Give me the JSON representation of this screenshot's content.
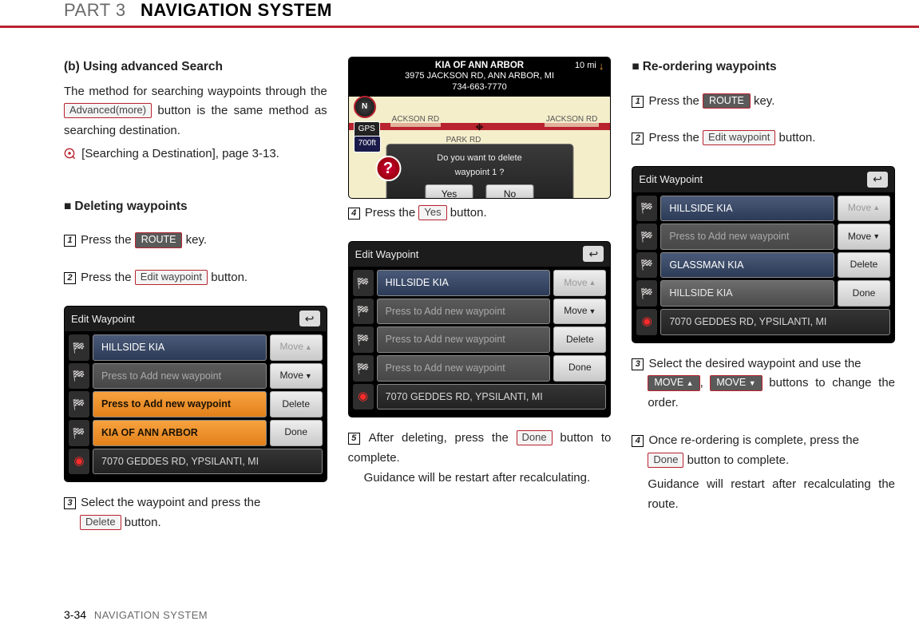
{
  "header": {
    "part": "PART 3",
    "title": "NAVIGATION SYSTEM"
  },
  "footer": {
    "page": "3-34",
    "section": "NAVIGATION SYSTEM"
  },
  "col1": {
    "advSearch": {
      "heading": "(b) Using advanced Search",
      "body1a": "The method for searching waypoints through the ",
      "btn_advanced": "Advanced(more)",
      "body1b": " button is the same method as searching destination.",
      "ref": "[Searching a Destination], page 3-13."
    },
    "deleting": {
      "heading": "Deleting waypoints",
      "step1a": "Press the ",
      "route_key": "ROUTE",
      "step1b": " key.",
      "step2a": "Press the ",
      "edit_waypoint_btn": "Edit waypoint",
      "step2b": " button.",
      "step3a": "Select the waypoint and press the ",
      "delete_btn": "Delete",
      "step3b": " button."
    },
    "ss1": {
      "title": "Edit Waypoint",
      "rows": [
        {
          "label": "HILLSIDE KIA"
        },
        {
          "label": "Press to Add new waypoint"
        },
        {
          "label": "Press to Add new waypoint"
        },
        {
          "label": "KIA OF ANN ARBOR"
        }
      ],
      "final": "7070 GEDDES RD, YPSILANTI, MI",
      "btns": {
        "moveUp": "Move",
        "moveDown": "Move",
        "delete": "Delete",
        "done": "Done"
      }
    }
  },
  "col2": {
    "map": {
      "title1": "KIA OF ANN ARBOR",
      "title2": "3975 JACKSON RD, ANN ARBOR, MI",
      "phone": "734-663-7770",
      "dist": "10 mi",
      "gps": "GPS",
      "scale": "700ft",
      "road_left": "ACKSON RD",
      "road_right": "JACKSON RD",
      "park": "PARK RD",
      "compass": "N",
      "dialog_text1": "Do you want to delete",
      "dialog_text2": "waypoint 1 ?",
      "yes": "Yes",
      "no": "No"
    },
    "step4a": "Press the ",
    "yes_btn": "Yes",
    "step4b": " button.",
    "ss2": {
      "title": "Edit Waypoint",
      "rows": [
        {
          "label": "HILLSIDE KIA"
        },
        {
          "label": "Press to Add new waypoint"
        },
        {
          "label": "Press to Add new waypoint"
        },
        {
          "label": "Press to Add new waypoint"
        }
      ],
      "final": "7070 GEDDES RD, YPSILANTI, MI",
      "btns": {
        "moveUp": "Move",
        "moveDown": "Move",
        "delete": "Delete",
        "done": "Done"
      }
    },
    "step5a": "After deleting, press the ",
    "done_btn": "Done",
    "step5b": " button to complete.",
    "step5c": "Guidance will be  restart after recalculating."
  },
  "col3": {
    "heading": "Re-ordering waypoints",
    "step1a": "Press the ",
    "route_key": "ROUTE",
    "step1b": " key.",
    "step2a": "Press the ",
    "edit_waypoint_btn": "Edit waypoint",
    "step2b": " button.",
    "ss3": {
      "title": "Edit Waypoint",
      "rows": [
        {
          "label": "HILLSIDE KIA"
        },
        {
          "label": "Press to Add new waypoint"
        },
        {
          "label": "GLASSMAN KIA"
        },
        {
          "label": "HILLSIDE KIA"
        }
      ],
      "final": "7070 GEDDES RD, YPSILANTI, MI",
      "btns": {
        "moveUp": "Move",
        "moveDown": "Move",
        "delete": "Delete",
        "done": "Done"
      }
    },
    "step3a": "Select the desired waypoint and use the ",
    "moveUp": "MOVE",
    "moveDown": "MOVE",
    "step3b": " buttons to change the order.",
    "step4a": "Once re-ordering is complete, press the ",
    "done_btn": "Done",
    "step4b": " button to complete.",
    "step4c": "Guidance will restart after recalculating the route."
  },
  "step_nums": {
    "1": "1",
    "2": "2",
    "3": "3",
    "4": "4",
    "5": "5"
  },
  "comma": ",  "
}
